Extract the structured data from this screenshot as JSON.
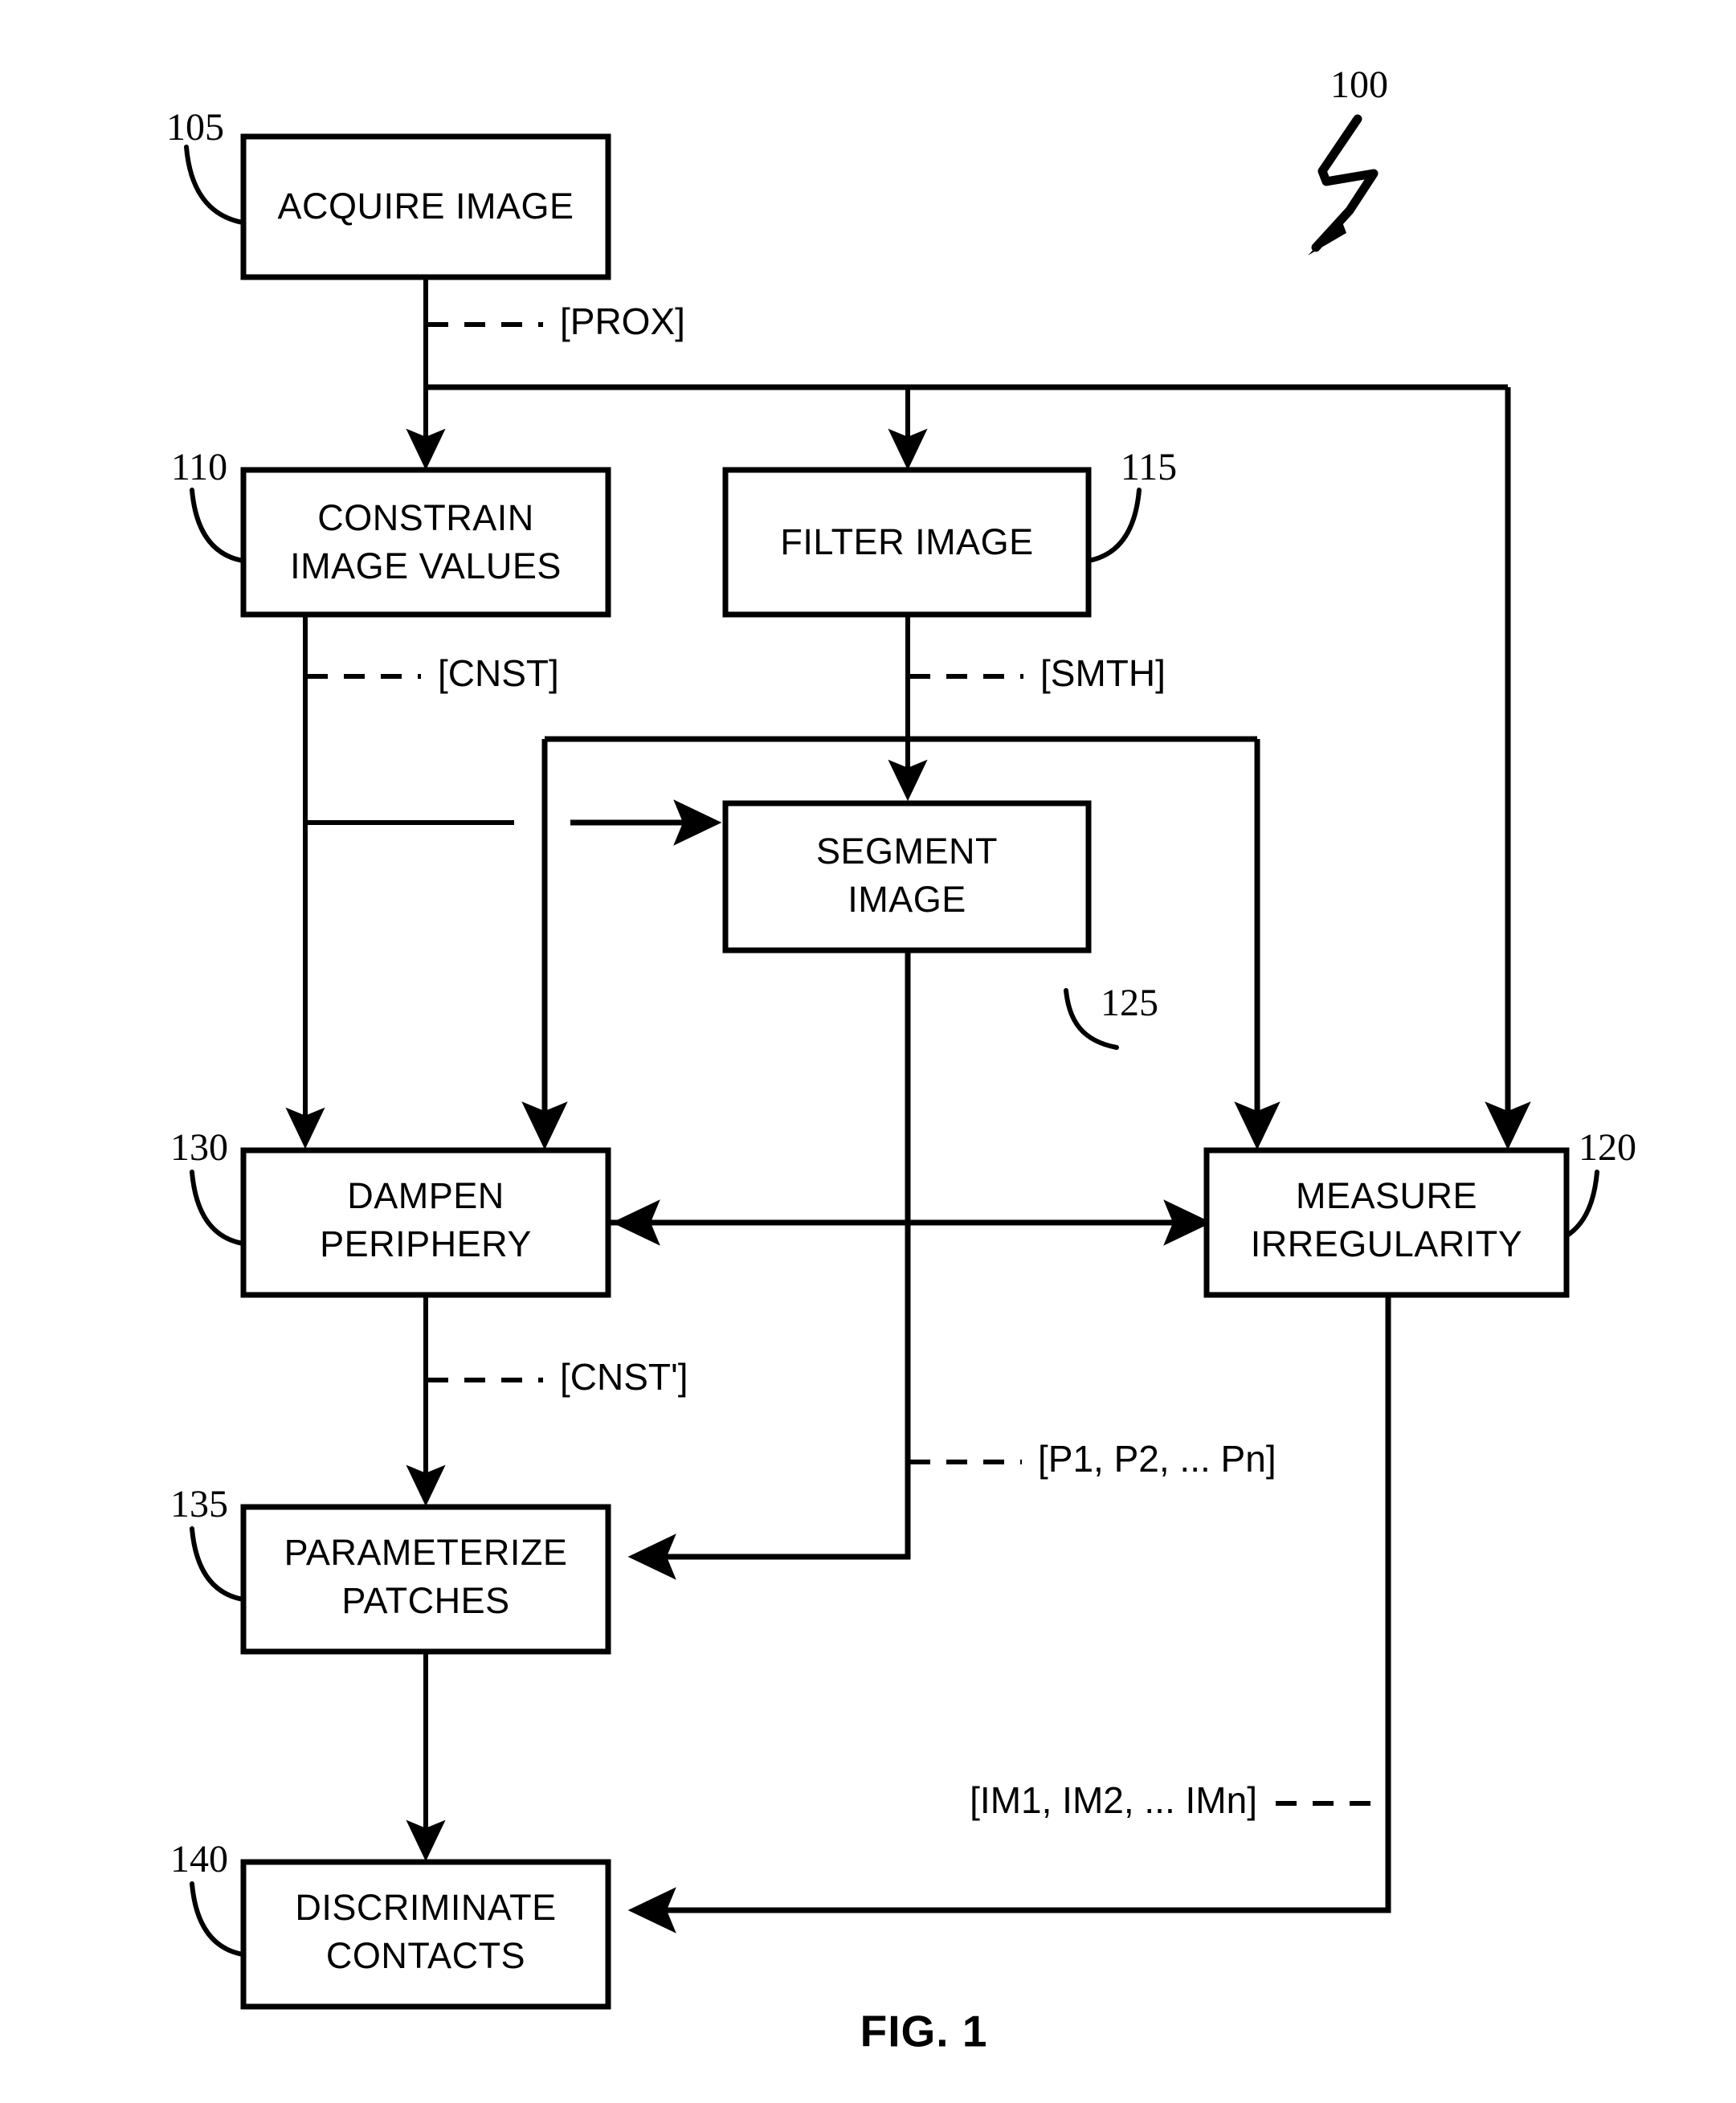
{
  "figure": {
    "caption": "FIG. 1",
    "diagram_ref": "100"
  },
  "nodes": [
    {
      "id": "acquire",
      "ref": "105",
      "line1": "ACQUIRE IMAGE",
      "line2": ""
    },
    {
      "id": "constrain",
      "ref": "110",
      "line1": "CONSTRAIN",
      "line2": "IMAGE VALUES"
    },
    {
      "id": "filter",
      "ref": "115",
      "line1": "FILTER IMAGE",
      "line2": ""
    },
    {
      "id": "measure",
      "ref": "120",
      "line1": "MEASURE",
      "line2": "IRREGULARITY"
    },
    {
      "id": "segment",
      "ref": "125",
      "line1": "SEGMENT",
      "line2": "IMAGE"
    },
    {
      "id": "dampen",
      "ref": "130",
      "line1": "DAMPEN",
      "line2": "PERIPHERY"
    },
    {
      "id": "parameterize",
      "ref": "135",
      "line1": "PARAMETERIZE",
      "line2": "PATCHES"
    },
    {
      "id": "discriminate",
      "ref": "140",
      "line1": "DISCRIMINATE",
      "line2": "CONTACTS"
    }
  ],
  "signals": {
    "prox": "[PROX]",
    "cnst": "[CNST]",
    "smth": "[SMTH]",
    "cnst_p": "[CNST']",
    "patches": "[P1, P2, ... Pn]",
    "irreg": "[IM1, IM2, ... IMn]"
  },
  "colors": {
    "stroke": "#000000",
    "fill": "#ffffff"
  }
}
